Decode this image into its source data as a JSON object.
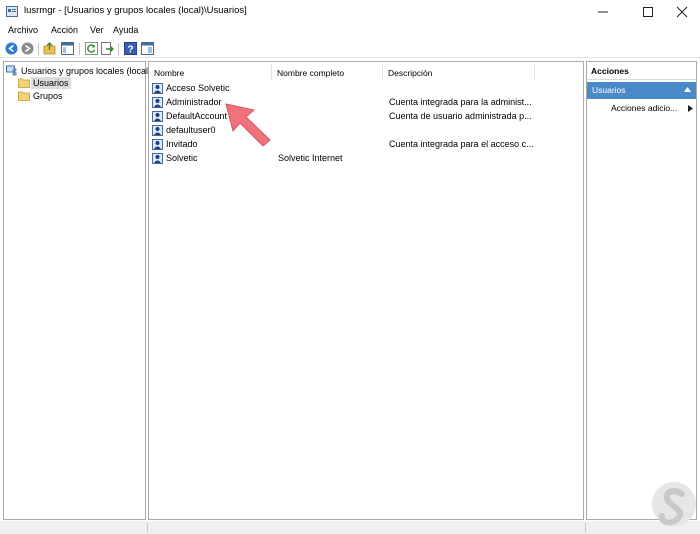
{
  "window": {
    "title": "lusrmgr - [Usuarios y grupos locales (local)\\Usuarios]",
    "controls": [
      "minimize-icon",
      "maximize-icon",
      "close-icon"
    ]
  },
  "menu": [
    "Archivo",
    "Acción",
    "Ver",
    "Ayuda"
  ],
  "toolbar": {
    "icons": [
      "back-icon",
      "forward-icon",
      "up-folder-icon",
      "show-tree-icon",
      "refresh-icon",
      "export-icon",
      "help-icon",
      "properties-icon"
    ]
  },
  "tree": {
    "root": "Usuarios y grupos locales (local)",
    "items": [
      {
        "label": "Usuarios",
        "selected": true
      },
      {
        "label": "Grupos",
        "selected": false
      }
    ]
  },
  "list": {
    "columns": [
      "Nombre",
      "Nombre completo",
      "Descripción"
    ],
    "rows": [
      {
        "name": "Acceso Solvetic",
        "full_name": "",
        "description": ""
      },
      {
        "name": "Administrador",
        "full_name": "",
        "description": "Cuenta integrada para la administ..."
      },
      {
        "name": "DefaultAccount",
        "full_name": "",
        "description": "Cuenta de usuario administrada p..."
      },
      {
        "name": "defaultuser0",
        "full_name": "",
        "description": ""
      },
      {
        "name": "Invitado",
        "full_name": "",
        "description": "Cuenta integrada para el acceso c..."
      },
      {
        "name": "Solvetic",
        "full_name": "Solvetic Internet",
        "description": ""
      }
    ]
  },
  "actions": {
    "title": "Acciones",
    "section": "Usuarios",
    "items": [
      "Acciones adicio..."
    ]
  },
  "colors": {
    "accent": "#4b8ac9",
    "selection": "#dcdcdc",
    "annotation_arrow": "#f0727a"
  }
}
